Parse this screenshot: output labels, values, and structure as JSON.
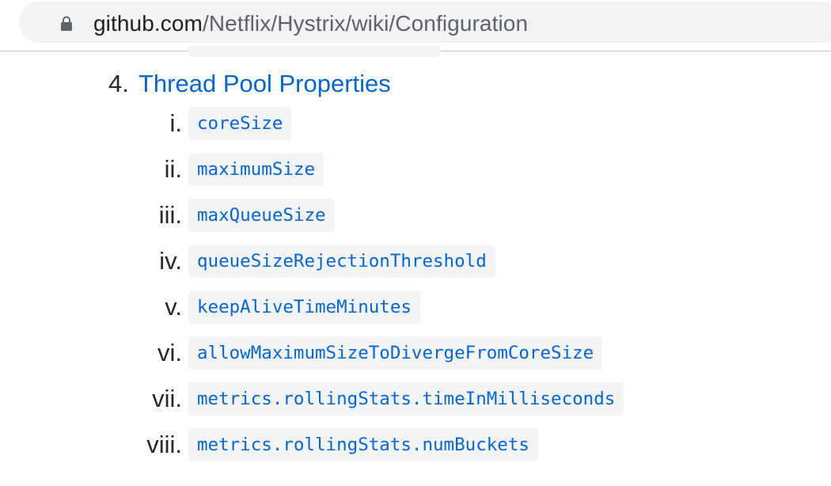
{
  "browser": {
    "url_host": "github.com",
    "url_path": "/Netflix/Hystrix/wiki/Configuration",
    "lock_icon": "lock-icon"
  },
  "section": {
    "number": "4.",
    "title": "Thread Pool Properties",
    "link_color": "#0366d6"
  },
  "properties": [
    {
      "numeral": "i.",
      "name": "coreSize"
    },
    {
      "numeral": "ii.",
      "name": "maximumSize"
    },
    {
      "numeral": "iii.",
      "name": "maxQueueSize"
    },
    {
      "numeral": "iv.",
      "name": "queueSizeRejectionThreshold"
    },
    {
      "numeral": "v.",
      "name": "keepAliveTimeMinutes"
    },
    {
      "numeral": "vi.",
      "name": "allowMaximumSizeToDivergeFromCoreSize"
    },
    {
      "numeral": "vii.",
      "name": "metrics.rollingStats.timeInMilliseconds"
    },
    {
      "numeral": "viii.",
      "name": "metrics.rollingStats.numBuckets"
    }
  ]
}
